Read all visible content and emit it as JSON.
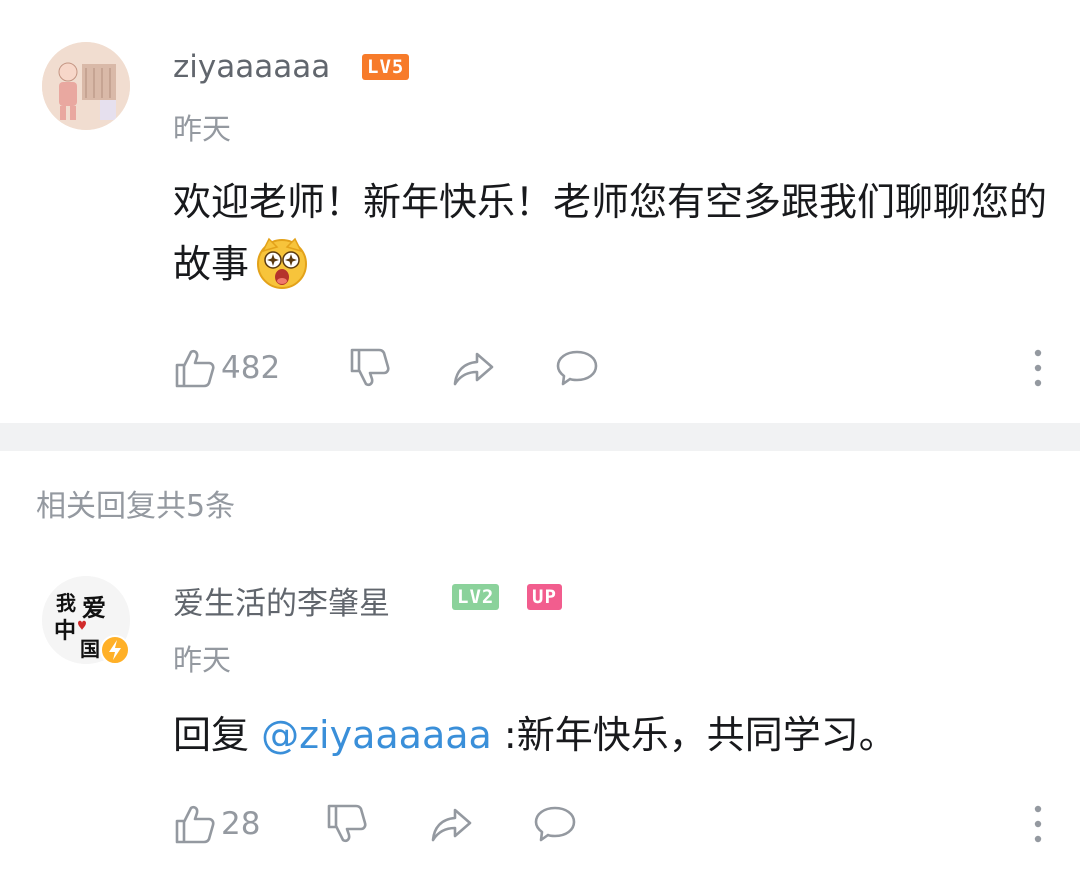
{
  "comments": [
    {
      "username": "ziyaaaaaa",
      "level": "LV5",
      "level_color": "#f77b2a",
      "time": "昨天",
      "content": "欢迎老师！新年快乐！老师您有空多跟我们聊聊您的故事",
      "emoji": "star-eyes-emoji",
      "likes": "482"
    },
    {
      "username": "爱生活的李肇星",
      "level": "LV2",
      "level_color": "#8bd29b",
      "up_badge": "UP",
      "up_color": "#f25d8e",
      "time": "昨天",
      "reply_prefix": "回复",
      "mention": "@ziyaaaaaa",
      "reply_text": ":新年快乐，共同学习。",
      "likes": "28",
      "avatar_text": [
        "我",
        "爱",
        "中",
        "国"
      ]
    }
  ],
  "replies_header": "相关回复共5条",
  "icons": [
    "like-icon",
    "dislike-icon",
    "share-icon",
    "reply-icon",
    "more-icon"
  ],
  "colors": {
    "mention": "#3a8fd9",
    "secondary_text": "#9499a0",
    "divider": "#f1f2f3"
  }
}
